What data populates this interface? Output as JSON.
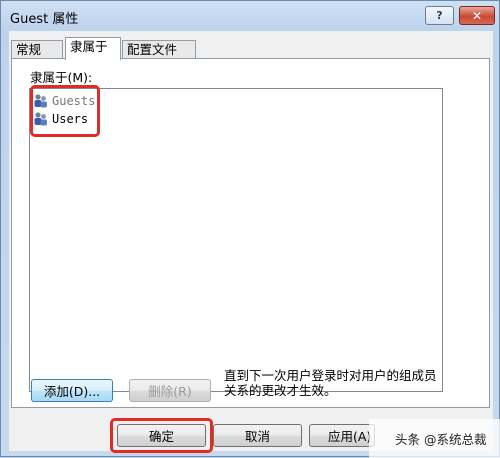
{
  "window": {
    "title": "Guest 属性",
    "help_label": "?",
    "close_label": "✕"
  },
  "tabs": [
    {
      "label": "常规",
      "active": false
    },
    {
      "label": "隶属于",
      "active": true
    },
    {
      "label": "配置文件",
      "active": false
    }
  ],
  "member_of": {
    "label": "隶属于(M):",
    "items": [
      {
        "name": "Guests",
        "icon": "users-group-icon"
      },
      {
        "name": "Users",
        "icon": "users-group-icon"
      }
    ]
  },
  "actions": {
    "add_label": "添加(D)...",
    "remove_label": "删除(R)"
  },
  "note": "直到下一次用户登录时对用户的组成员关系的更改才生效。",
  "footer": {
    "ok_label": "确定",
    "cancel_label": "取消",
    "apply_label": "应用(A)"
  },
  "watermark": "头条 @系统总裁",
  "colors": {
    "highlight": "#e02b26",
    "dialog_bg": "#f0f0f0",
    "title_bg": "#c6d9ee"
  }
}
